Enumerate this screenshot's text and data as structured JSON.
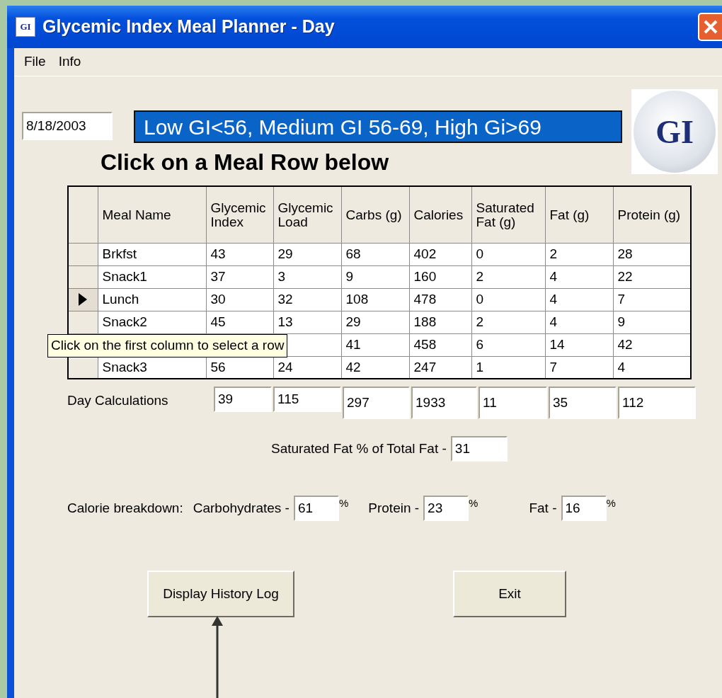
{
  "window": {
    "title": "Glycemic Index Meal Planner - Day",
    "icon_text": "GI"
  },
  "menu": [
    "File",
    "Info"
  ],
  "date": {
    "value": "8/18/2003"
  },
  "legend": "Low GI<56, Medium GI 56-69, High Gi>69",
  "logo": {
    "text": "GI"
  },
  "heading": "Click on a Meal Row below",
  "table": {
    "columns": [
      "Meal Name",
      "Glycemic Index",
      "Glycemic Load",
      "Carbs (g)",
      "Calories",
      "Saturated Fat (g)",
      "Fat (g)",
      "Protein (g)"
    ],
    "rows": [
      {
        "selected": false,
        "cells": [
          "Brkfst",
          "43",
          "29",
          "68",
          "402",
          "0",
          "2",
          "28"
        ]
      },
      {
        "selected": false,
        "cells": [
          "Snack1",
          "37",
          "3",
          "9",
          "160",
          "2",
          "4",
          "22"
        ]
      },
      {
        "selected": true,
        "cells": [
          "Lunch",
          "30",
          "32",
          "108",
          "478",
          "0",
          "4",
          "7"
        ]
      },
      {
        "selected": false,
        "cells": [
          "Snack2",
          "45",
          "13",
          "29",
          "188",
          "2",
          "4",
          "9"
        ]
      },
      {
        "cells": [
          null,
          null,
          null,
          "41",
          "458",
          "6",
          "14",
          "42"
        ]
      },
      {
        "selected": false,
        "cells": [
          "Snack3",
          "56",
          "24",
          "42",
          "247",
          "1",
          "7",
          "4"
        ]
      }
    ]
  },
  "tooltip": "Click on the first column to select a row",
  "day_calculations": {
    "label": "Day Calculations",
    "values": [
      "39",
      "115",
      "297",
      "1933",
      "11",
      "35",
      "112"
    ]
  },
  "saturated_fat": {
    "label": "Saturated Fat % of Total Fat -",
    "value": "31"
  },
  "calorie_breakdown": {
    "label": "Calorie breakdown:",
    "items": [
      {
        "label": "Carbohydrates -",
        "value": "61",
        "unit": "%"
      },
      {
        "label": "Protein -",
        "value": "23",
        "unit": "%"
      },
      {
        "label": "Fat -",
        "value": "16",
        "unit": "%"
      }
    ]
  },
  "buttons": [
    "Display History Log",
    "Exit"
  ]
}
